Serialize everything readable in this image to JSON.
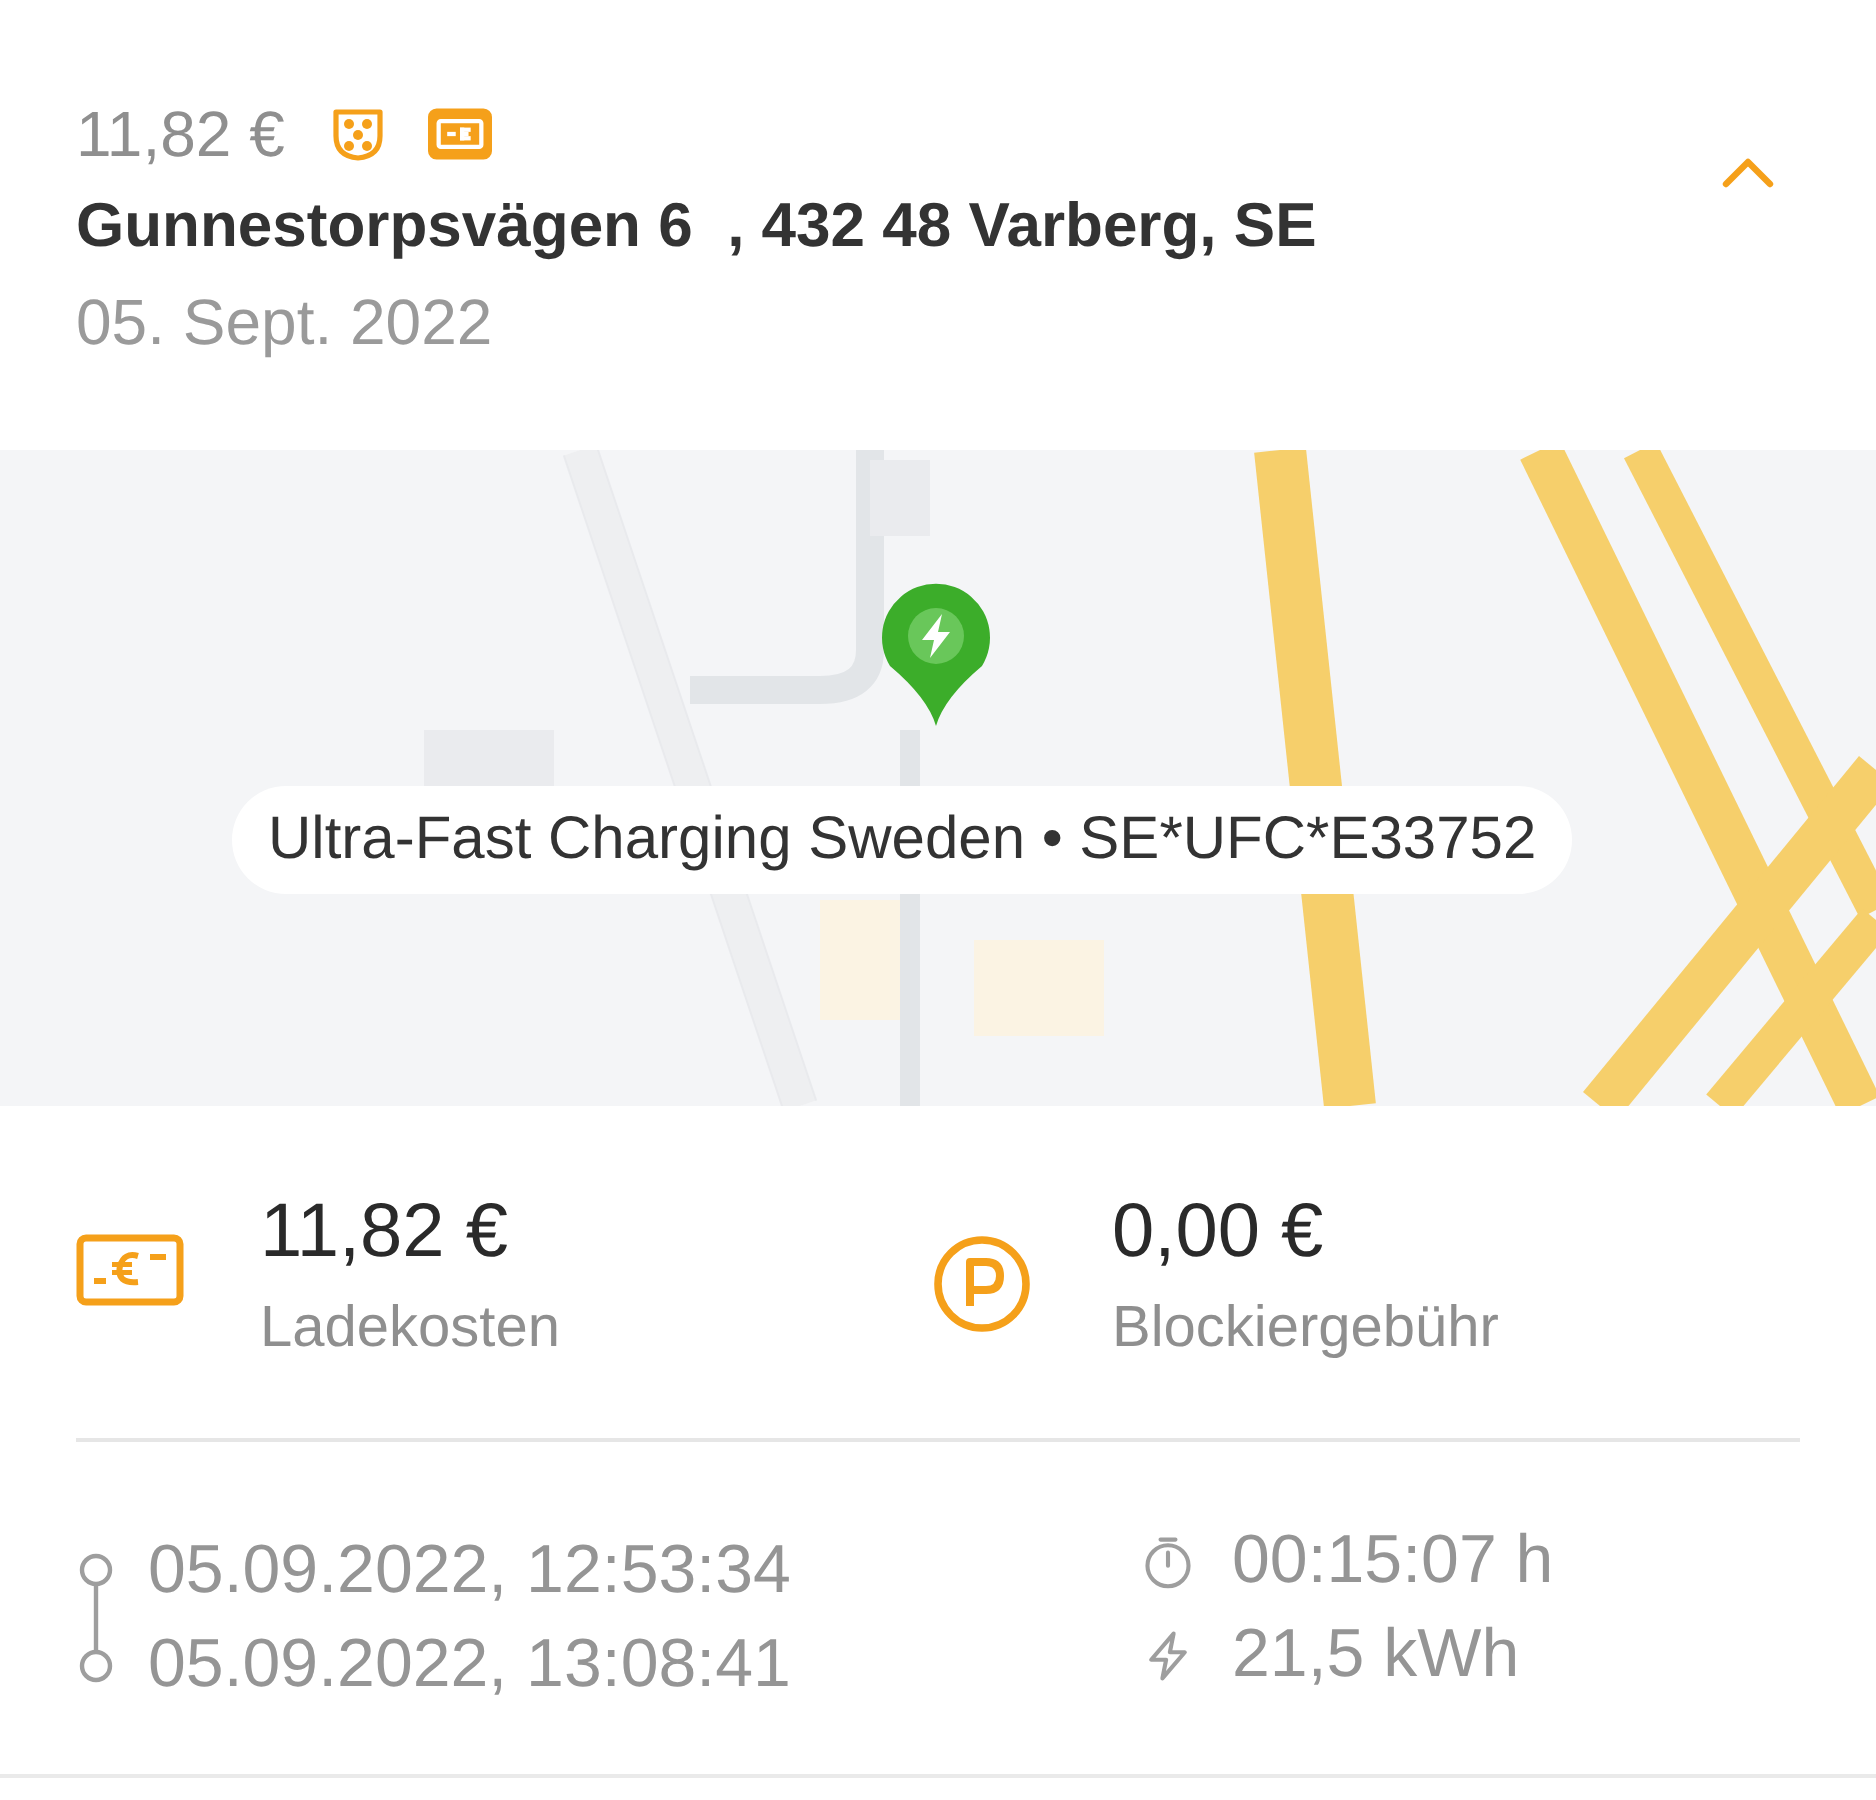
{
  "header": {
    "price": "11,82 €",
    "address": "Gunnestorpsvägen 6  , 432 48 Varberg, SE",
    "date": "05. Sept. 2022",
    "expanded": true
  },
  "map": {
    "kind": "picture",
    "station_label": "Ultra-Fast Charging Sweden • SE*UFC*E33752"
  },
  "costs": [
    {
      "kind": "charging",
      "amount": "11,82 €",
      "label": "Ladekosten"
    },
    {
      "kind": "parking",
      "amount": "0,00 €",
      "label": "Blockiergebühr"
    }
  ],
  "session": {
    "start": "05.09.2022, 12:53:34",
    "end": "05.09.2022, 13:08:41",
    "duration": "00:15:07 h",
    "energy": "21,5 kWh"
  }
}
